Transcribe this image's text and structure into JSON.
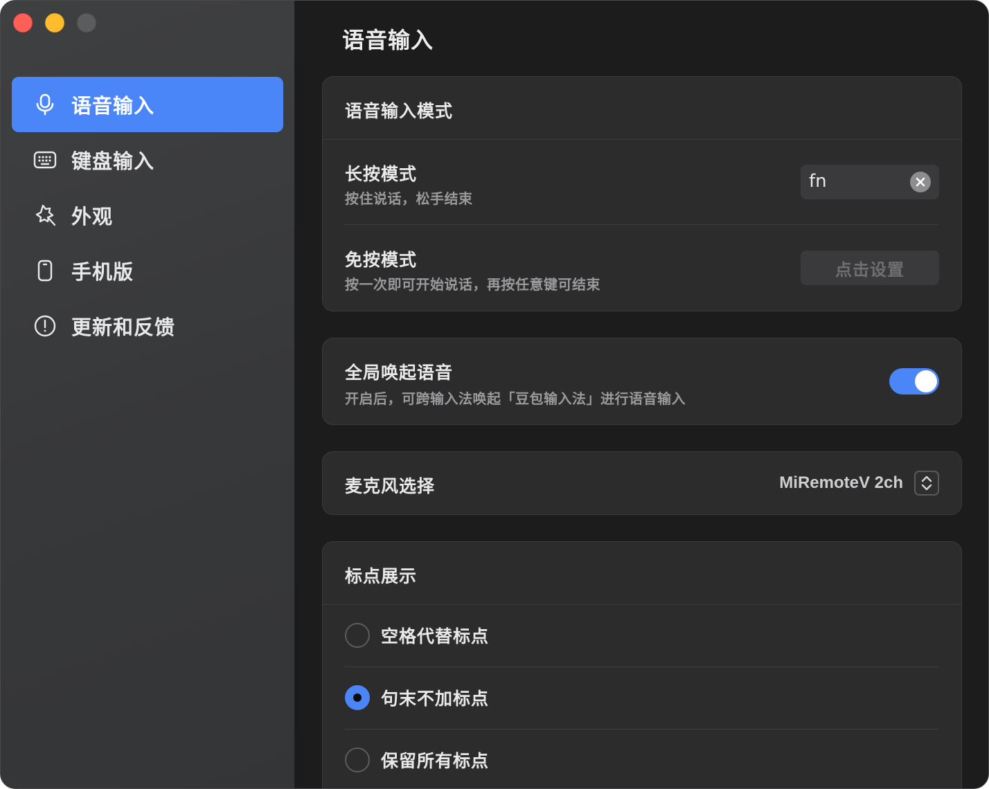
{
  "window": {
    "traffic_lights": [
      "close",
      "minimize",
      "zoom"
    ]
  },
  "sidebar": {
    "items": [
      {
        "label": "语音输入",
        "icon": "microphone-icon",
        "active": true
      },
      {
        "label": "键盘输入",
        "icon": "keyboard-icon",
        "active": false
      },
      {
        "label": "外观",
        "icon": "appearance-icon",
        "active": false
      },
      {
        "label": "手机版",
        "icon": "phone-icon",
        "active": false
      },
      {
        "label": "更新和反馈",
        "icon": "info-circle-icon",
        "active": false
      }
    ]
  },
  "main": {
    "title": "语音输入",
    "mode_card": {
      "header": "语音输入模式",
      "hold": {
        "title": "长按模式",
        "subtitle": "按住说话，松手结束",
        "key_value": "fn"
      },
      "handsfree": {
        "title": "免按模式",
        "subtitle": "按一次即可开始说话，再按任意键可结束",
        "button_label": "点击设置"
      }
    },
    "global_card": {
      "title": "全局唤起语音",
      "subtitle": "开启后，可跨输入法唤起「豆包输入法」进行语音输入",
      "enabled": true
    },
    "mic_card": {
      "title": "麦克风选择",
      "selected": "MiRemoteV 2ch"
    },
    "punct_card": {
      "header": "标点展示",
      "options": [
        {
          "label": "空格代替标点",
          "checked": false
        },
        {
          "label": "句末不加标点",
          "checked": true
        },
        {
          "label": "保留所有标点",
          "checked": false
        }
      ]
    }
  },
  "colors": {
    "accent": "#4a86f7",
    "sidebar_bg": "#3c3d3e",
    "main_bg": "#1c1c1d",
    "card_bg": "#2c2c2d"
  }
}
